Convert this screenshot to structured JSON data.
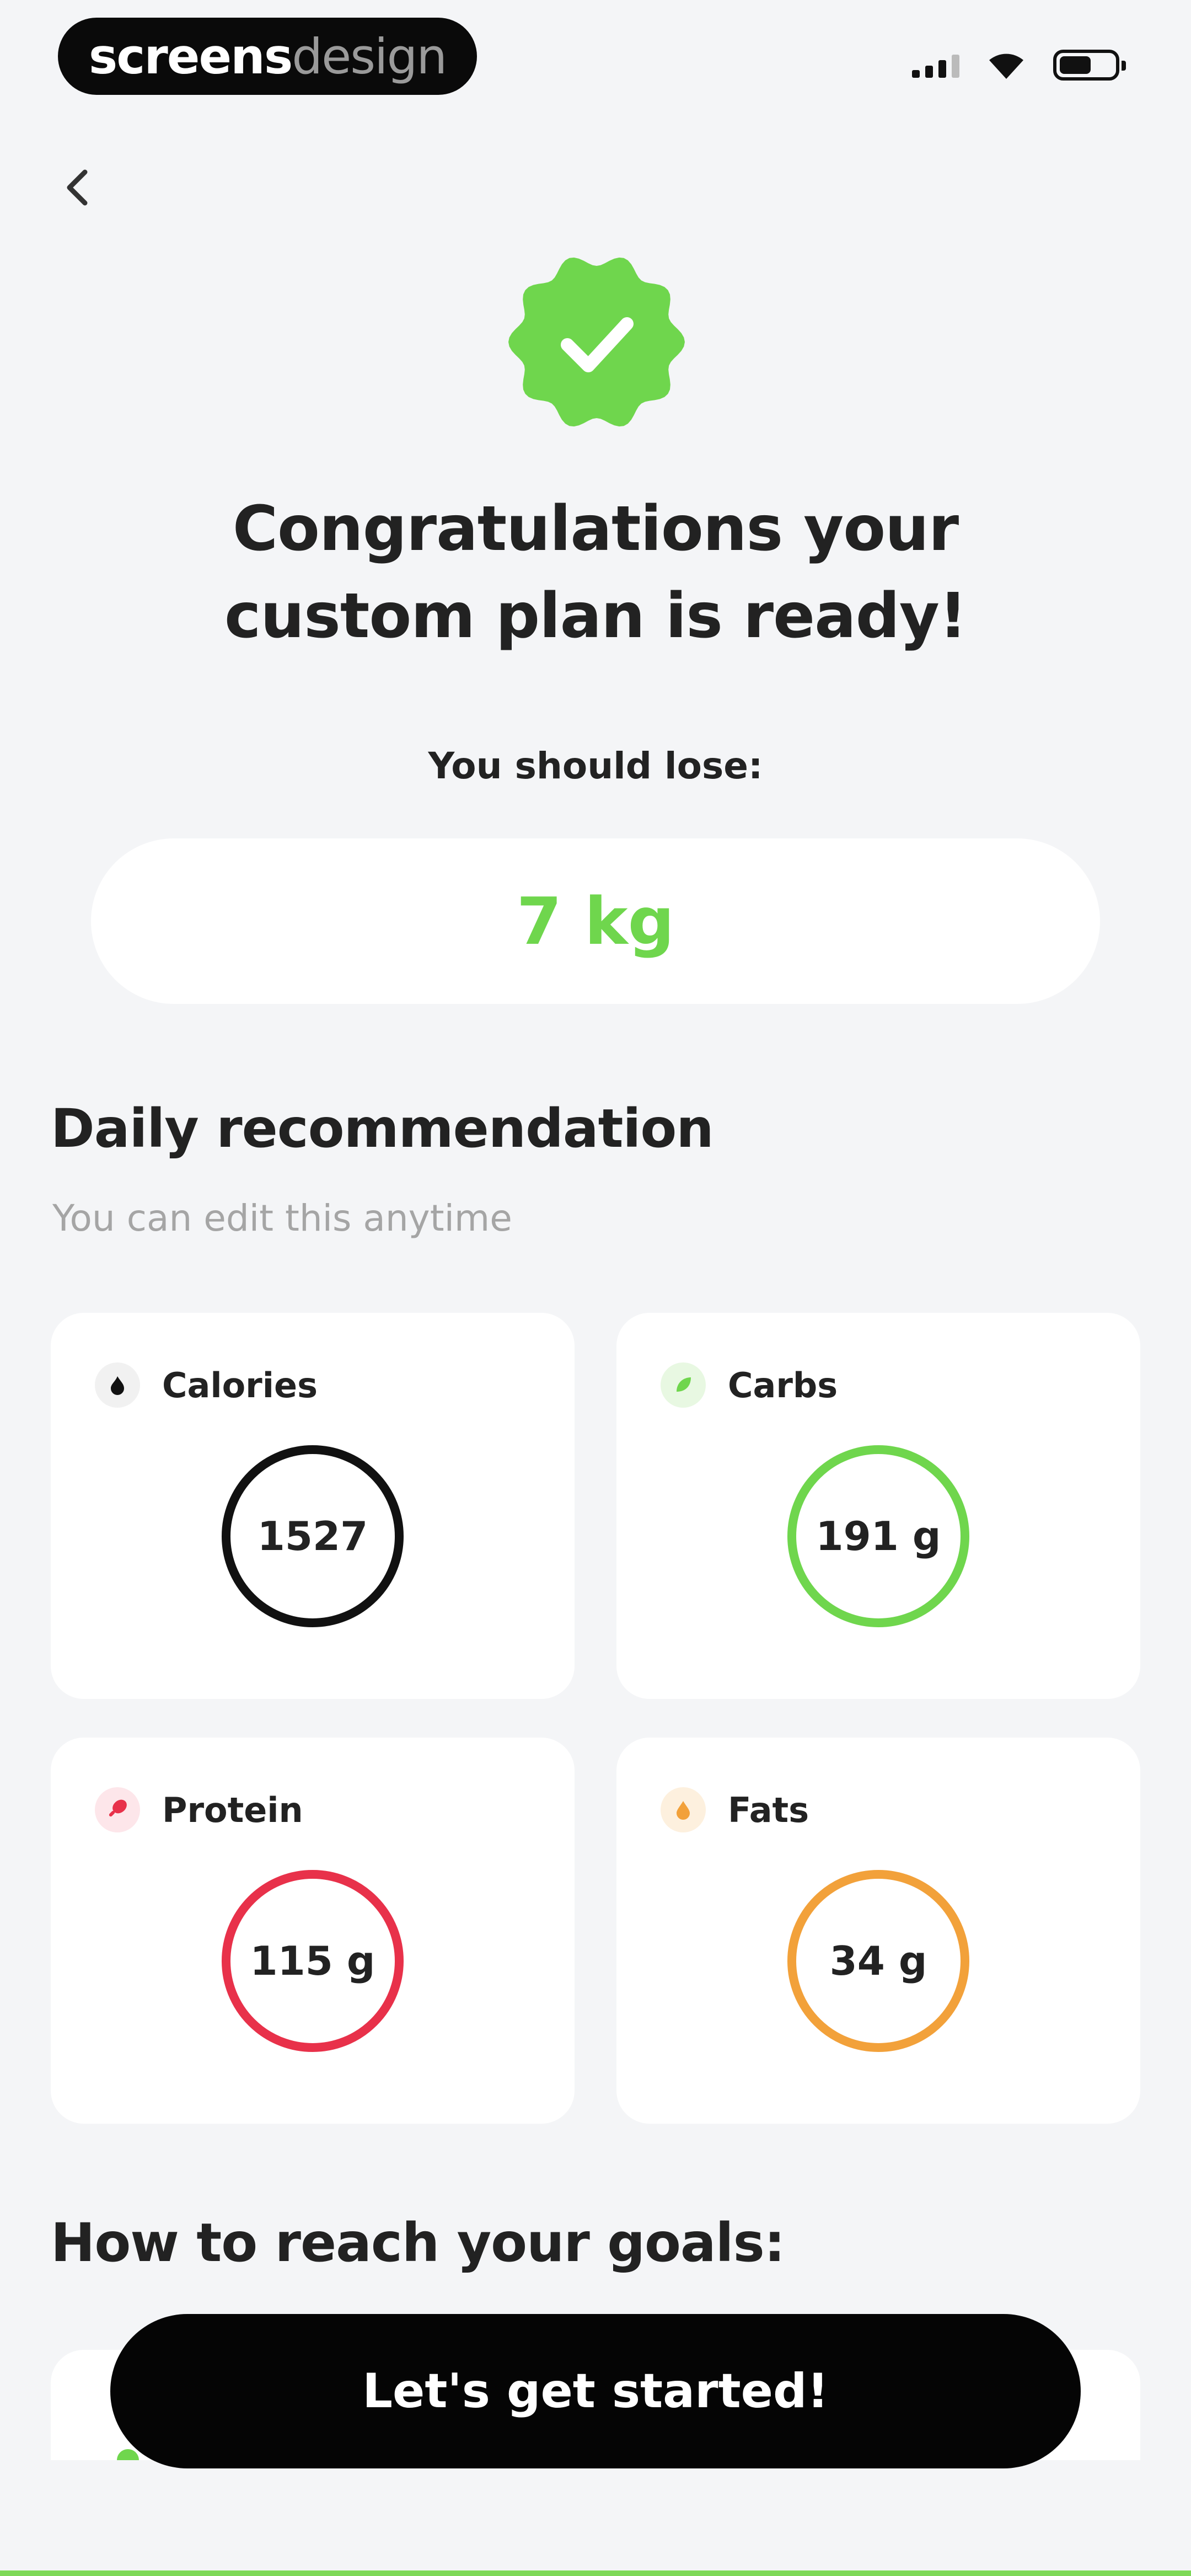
{
  "brand": {
    "bold": "screens",
    "light": "design"
  },
  "header": {
    "back_icon": "chevron-left-icon"
  },
  "hero": {
    "badge_icon": "check-badge-icon",
    "badge_color": "#6fd64d",
    "title": "Congratulations your custom plan is ready!"
  },
  "goal": {
    "label": "You should lose:",
    "value": "7 kg",
    "value_color": "#6fd64d"
  },
  "daily": {
    "title": "Daily recommendation",
    "subtitle": "You can edit this anytime",
    "cards": [
      {
        "label": "Calories",
        "value": "1527",
        "color": "#111111",
        "icon": "flame-icon"
      },
      {
        "label": "Carbs",
        "value": "191 g",
        "color": "#6fd64d",
        "icon": "leaf-icon"
      },
      {
        "label": "Protein",
        "value": "115 g",
        "color": "#e8314a",
        "icon": "drumstick-icon"
      },
      {
        "label": "Fats",
        "value": "34 g",
        "color": "#f2a13a",
        "icon": "drop-icon"
      }
    ]
  },
  "goals": {
    "title": "How to reach your goals:"
  },
  "cta": {
    "label": "Let's get started!"
  }
}
